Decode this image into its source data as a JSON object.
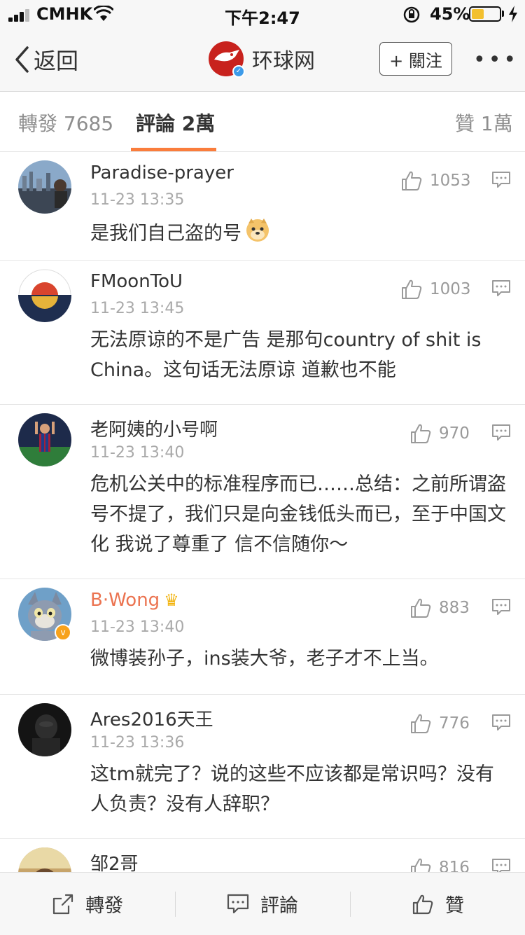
{
  "status_bar": {
    "carrier": "CMHK",
    "time": "下午2:47",
    "battery": "45%",
    "battery_level": 0.45
  },
  "nav": {
    "back_label": "返回",
    "account_name": "环球网",
    "follow_label": "+ 關注",
    "more_label": "•••"
  },
  "tabs": {
    "repost": "轉發 7685",
    "comments": "評論 2萬",
    "likes": "贊 1萬"
  },
  "comments": [
    {
      "name": "Paradise-prayer",
      "time": "11-23 13:35",
      "likes": "1053",
      "text": "是我们自己盗的号",
      "emoji": "doge-emoji"
    },
    {
      "name": "FMoonToU",
      "time": "11-23 13:45",
      "likes": "1003",
      "text": "无法原谅的不是广告 是那句country of shit is China。这句话无法原谅 道歉也不能"
    },
    {
      "name": "老阿姨的小号啊",
      "time": "11-23 13:40",
      "likes": "970",
      "text": "危机公关中的标准程序而已……总结：之前所谓盗号不提了，我们只是向金钱低头而已，至于中国文化 我说了尊重了 信不信随你～"
    },
    {
      "name": "B·Wong",
      "time": "11-23 13:40",
      "likes": "883",
      "text": "微博装孙子，ins装大爷，老子才不上当。",
      "vip": true
    },
    {
      "name": "Ares2016天王",
      "time": "11-23 13:36",
      "likes": "776",
      "text": "这tm就完了？说的这些不应该都是常识吗？没有人负责？没有人辞职？"
    },
    {
      "name": "邹2哥",
      "time": "",
      "likes": "816",
      "text": ""
    }
  ],
  "bottom_bar": {
    "repost": "轉發",
    "comment": "評論",
    "like": "贊"
  },
  "colors": {
    "accent": "#fa7d3c",
    "vip_name": "#eb7350",
    "brand_red": "#c8221d",
    "verified_blue": "#3d9be9",
    "verified_gold": "#f7a21b"
  }
}
